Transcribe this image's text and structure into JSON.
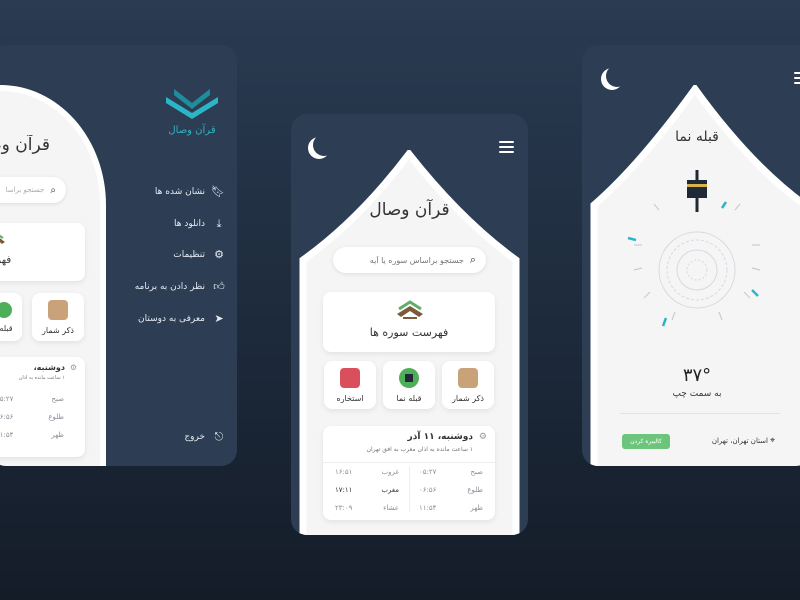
{
  "app": {
    "name": "قرآن وصال",
    "logo_text": "قرآن وصال"
  },
  "colors": {
    "teal": "#2bb5c6",
    "bg_dark": "#1d2a3b",
    "phone_bg": "#2d3e54",
    "card_bg": "#ffffff",
    "green_badge": "#6cc57a"
  },
  "search": {
    "placeholder": "جستجو براساس سوره یا آیه",
    "placeholder_clipped": "جستجو براسا"
  },
  "menu": {
    "items": [
      {
        "label": "نشان شده ها",
        "icon": "bookmark-icon"
      },
      {
        "label": "دانلود ها",
        "icon": "download-icon"
      },
      {
        "label": "تنظیمات",
        "icon": "gear-icon"
      },
      {
        "label": "نظر دادن به برنامه",
        "icon": "thumbs-up-icon"
      },
      {
        "label": "معرفی به دوستان",
        "icon": "send-icon"
      }
    ],
    "logout": "خروج"
  },
  "main": {
    "title": "قرآن وصال",
    "surah_list": "فهرست سوره ها",
    "surah_list_clipped": "فهرس",
    "shortcuts": [
      {
        "label": "ذکر شمار",
        "icon": "prayer-hands-icon"
      },
      {
        "label": "قبله نما",
        "icon": "kaaba-icon"
      },
      {
        "label": "استخاره",
        "icon": "quran-book-icon"
      }
    ],
    "qibla_clipped": "قبله"
  },
  "prayer": {
    "date": "دوشنبه، ۱۱ آذر",
    "date_clipped": "دوشنبه،",
    "subtitle": "۱ ساعت مانده به اذان مغرب به افق تهران",
    "subtitle_clipped": "۱ ساعت مانده به اذان",
    "times": [
      {
        "label": "صبح",
        "value": "۰۵:۲۷"
      },
      {
        "label": "طلوع",
        "value": "۰۶:۵۶"
      },
      {
        "label": "ظهر",
        "value": "۱۱:۵۴"
      },
      {
        "label": "غروب",
        "value": "۱۶:۵۱"
      },
      {
        "label": "مغرب",
        "value": "۱۷:۱۱"
      },
      {
        "label": "عشاء",
        "value": "۲۳:۰۹"
      }
    ]
  },
  "qibla": {
    "title": "قبله نما",
    "degree": "۳۷°",
    "direction": "به سمت چپ",
    "location": "استان تهران، تهران",
    "calibrate": "کالیبره کردن"
  }
}
